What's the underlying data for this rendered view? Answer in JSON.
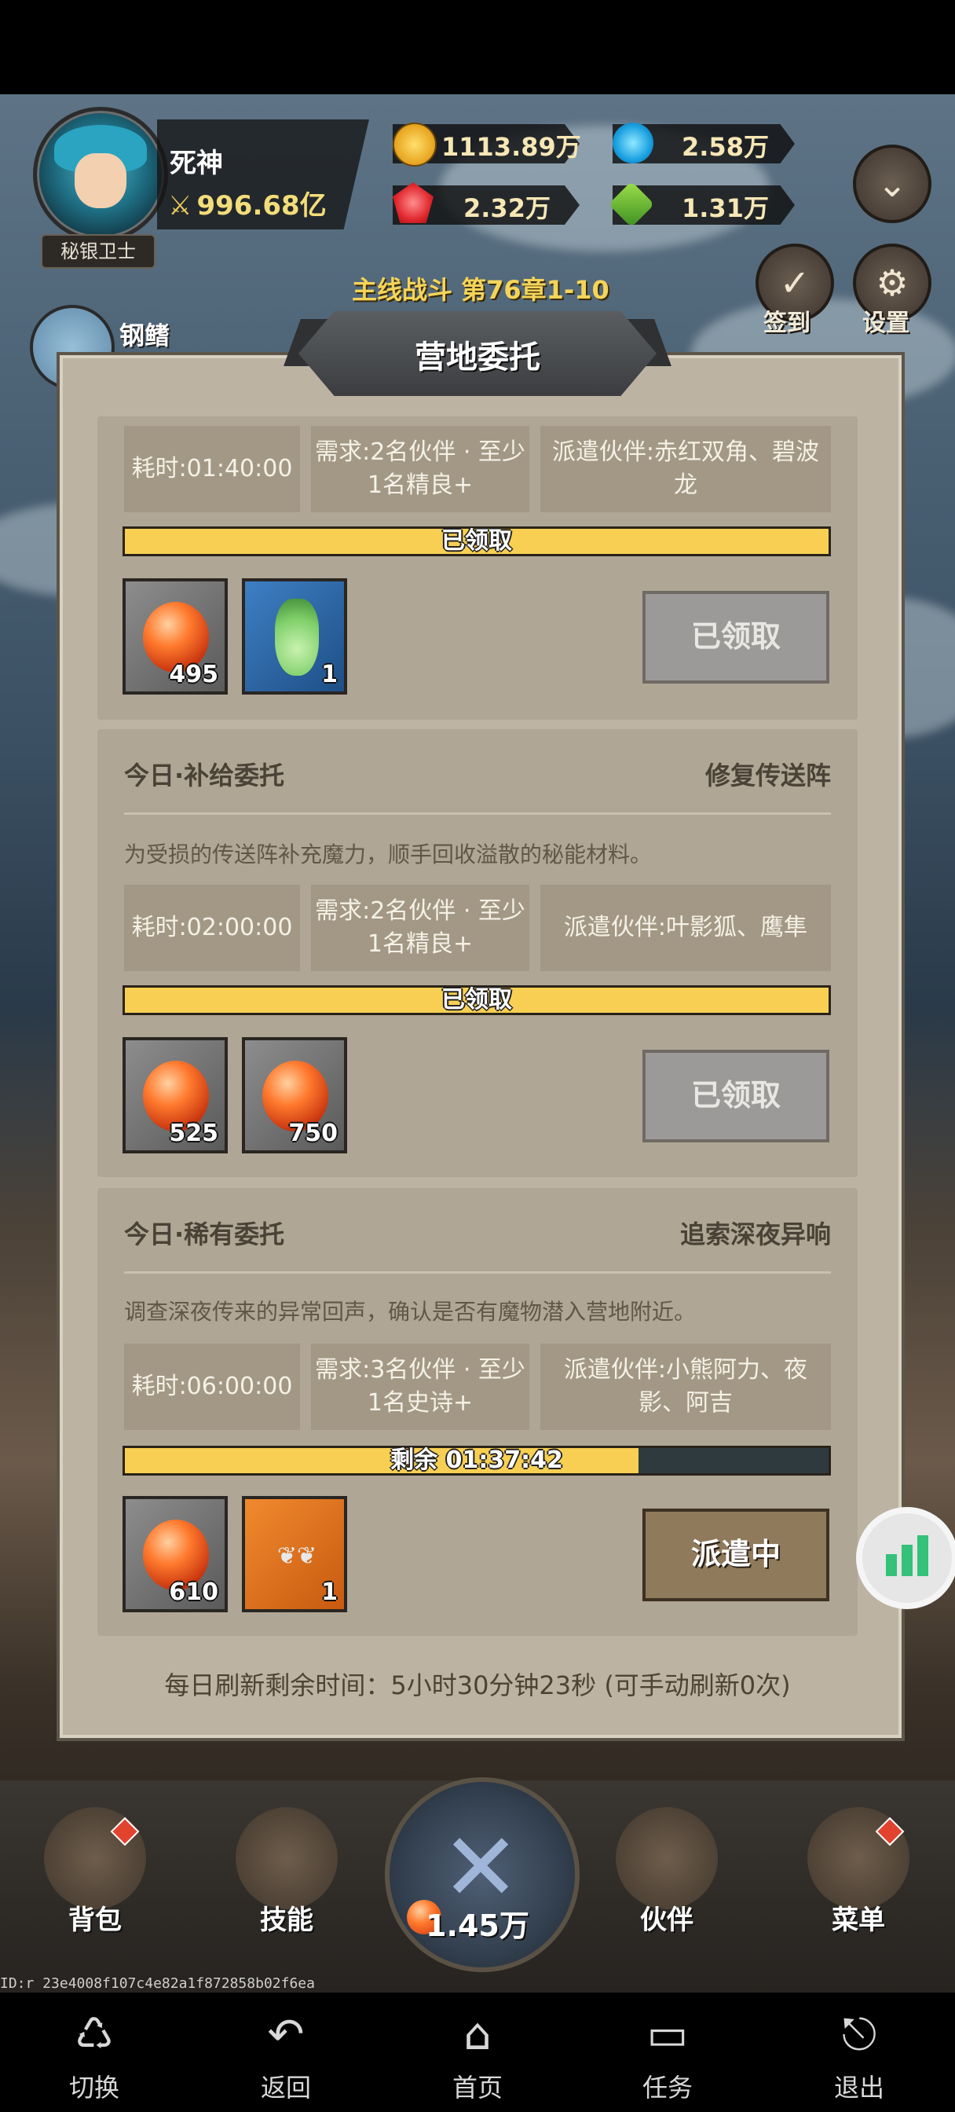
{
  "player": {
    "name": "死神",
    "power": "996.68亿",
    "rank": "秘银卫士"
  },
  "resources": {
    "gold": "1113.89万",
    "blue_gem": "2.58万",
    "red_gem": "2.32万",
    "green_item": "1.31万"
  },
  "side_buttons": {
    "checkin": "签到",
    "settings": "设置"
  },
  "stage": "主线战斗 第76章1-10",
  "ally": {
    "name": "钢鳍"
  },
  "dialog": {
    "title": "营地委托",
    "missions": [
      {
        "time": "耗时:01:40:00",
        "requirement": "需求:2名伙伴 · 至少1名精良+",
        "partners": "派遣伙伴:赤红双角、碧波龙",
        "bar_text": "已领取",
        "progress": 1.0,
        "rewards": [
          {
            "type": "orb",
            "count": "495"
          },
          {
            "type": "potion",
            "count": "1"
          }
        ],
        "button": "已领取"
      },
      {
        "head_left": "今日·补给委托",
        "head_right": "修复传送阵",
        "description": "为受损的传送阵补充魔力，顺手回收溢散的秘能材料。",
        "time": "耗时:02:00:00",
        "requirement": "需求:2名伙伴 · 至少1名精良+",
        "partners": "派遣伙伴:叶影狐、鹰隼",
        "bar_text": "已领取",
        "progress": 1.0,
        "rewards": [
          {
            "type": "orb",
            "count": "525"
          },
          {
            "type": "orb",
            "count": "750"
          }
        ],
        "button": "已领取"
      },
      {
        "head_left": "今日·稀有委托",
        "head_right": "追索深夜异响",
        "description": "调查深夜传来的异常回声，确认是否有魔物潜入营地附近。",
        "time": "耗时:06:00:00",
        "requirement": "需求:3名伙伴 · 至少1名史诗+",
        "partners": "派遣伙伴:小熊阿力、夜影、阿吉",
        "bar_text": "剩余 01:37:42",
        "progress": 0.73,
        "rewards": [
          {
            "type": "orb",
            "count": "610"
          },
          {
            "type": "wings",
            "count": "1"
          }
        ],
        "button": "派遣中"
      }
    ],
    "refresh_text": "每日刷新剩余时间：5小时30分钟23秒 (可手动刷新0次)"
  },
  "bottom_bar": {
    "bag": "背包",
    "skills": "技能",
    "center_value": "1.45万",
    "partners": "伙伴",
    "menu": "菜单"
  },
  "device_id": "ID:r 23e4008f107c4e82a1f872858b02f6ea",
  "system_nav": {
    "switch": "切换",
    "back": "返回",
    "home": "首页",
    "tasks": "任务",
    "exit": "退出"
  },
  "colors": {
    "accent_yellow": "#f8cf52",
    "panel": "#bcb3a3",
    "card": "#b0a695"
  }
}
